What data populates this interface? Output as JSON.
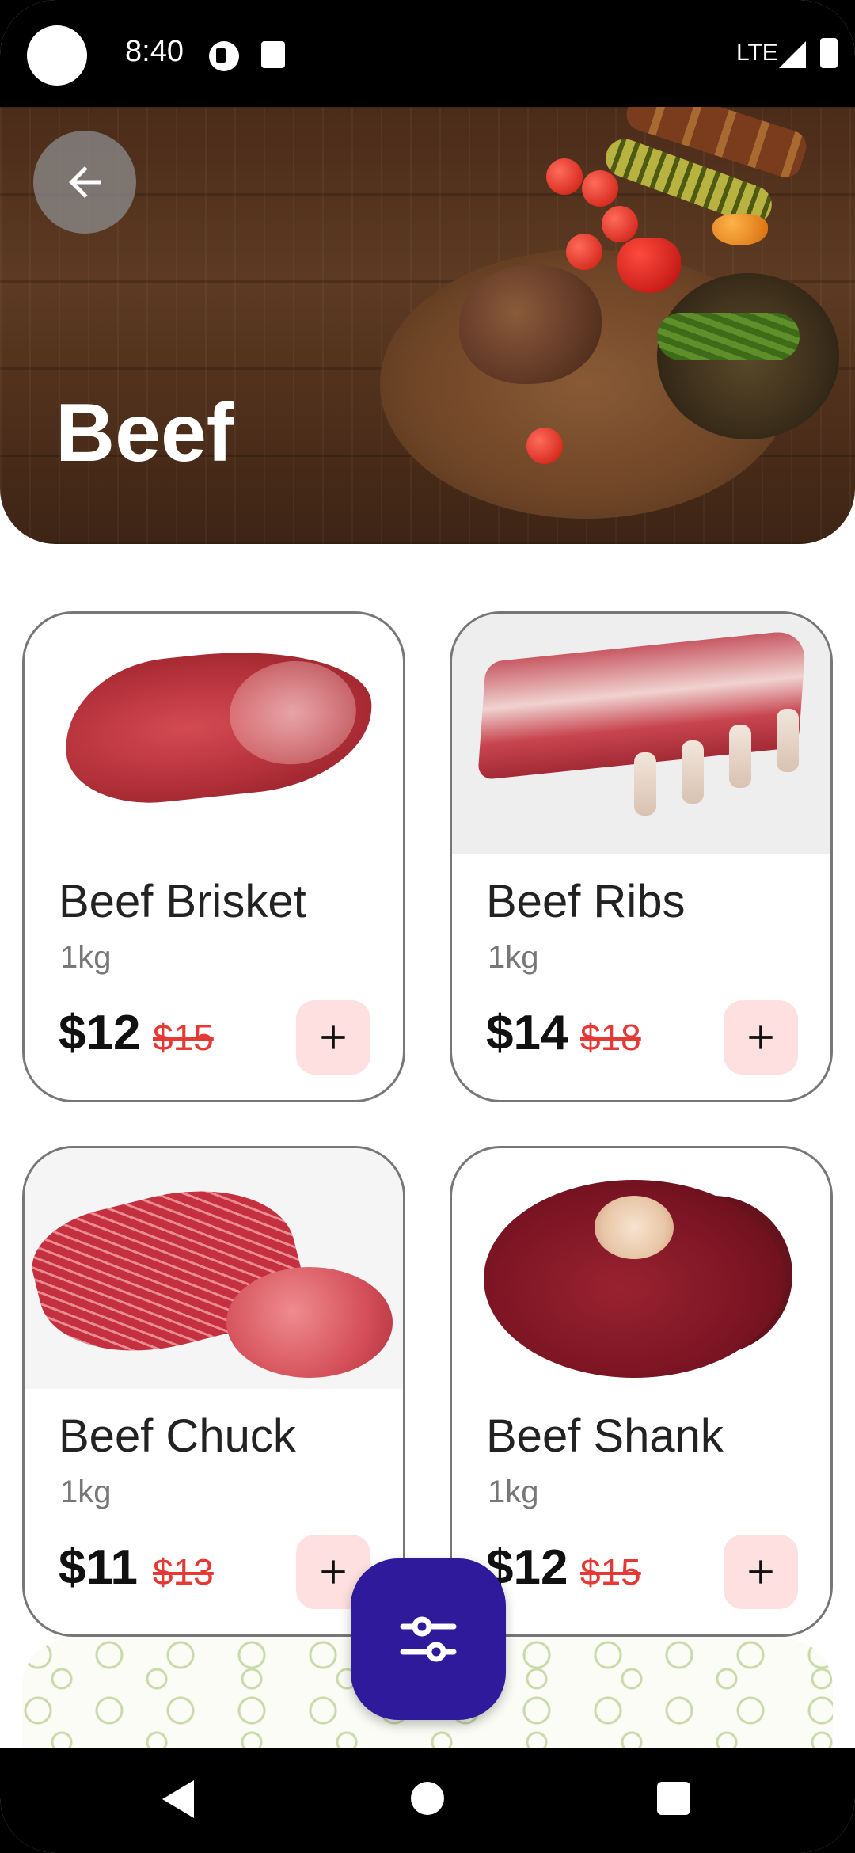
{
  "status_bar": {
    "time": "8:40",
    "network": "LTE"
  },
  "hero": {
    "title": "Beef",
    "back_icon": "arrow-left-icon"
  },
  "products": [
    {
      "name": "Beef Brisket",
      "weight": "1kg",
      "price": "$12",
      "old_price": "$15",
      "add_label": "+"
    },
    {
      "name": "Beef Ribs",
      "weight": "1kg",
      "price": "$14",
      "old_price": "$18",
      "add_label": "+"
    },
    {
      "name": "Beef Chuck",
      "weight": "1kg",
      "price": "$11",
      "old_price": "$13",
      "add_label": "+"
    },
    {
      "name": "Beef Shank",
      "weight": "1kg",
      "price": "$12",
      "old_price": "$15",
      "add_label": "+"
    }
  ],
  "fab": {
    "icon": "filter-sliders-icon"
  },
  "colors": {
    "fab": "#2e1a9b",
    "add_button_bg": "#fde0df",
    "old_price": "#e53935",
    "card_border": "#777777"
  }
}
